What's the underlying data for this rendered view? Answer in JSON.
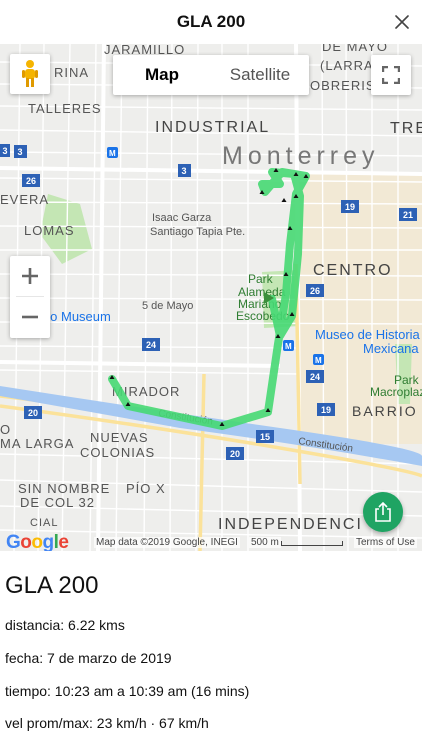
{
  "header": {
    "title": "GLA 200",
    "close_icon": "close-icon"
  },
  "map": {
    "type_control": {
      "map_label": "Map",
      "satellite_label": "Satellite",
      "selected": "Map"
    },
    "labels": {
      "jaramillo": "JARAMILLO",
      "de_mayo": "DE MAYO",
      "larra": "(LARRA",
      "obreris": "OBRERIS",
      "rina": "RINA",
      "talleres": "TALLERES",
      "industrial": "INDUSTRIAL",
      "tre": "TRE",
      "monterrey": "Monterrey",
      "evera": "EVERA",
      "isaac_garza": "Isaac Garza",
      "santiago_tapia": "Santiago Tapia Pte.",
      "lomas": "LOMAS",
      "centro": "CENTRO",
      "park": "Park",
      "alameda": "Alameda",
      "mariano": "Mariano",
      "escobedo": "Escobedo",
      "cinco_de_mayo": "5 de Mayo",
      "pabado_museum": "pabado Museum",
      "museo_historia_1": "Museo de Historia",
      "museo_historia_2": "Mexicana",
      "park2": "Park",
      "macroplaza": "Macroplaza",
      "mirador": "MIRADOR",
      "barrio": "BARRIO",
      "constitucion_1": "Constitución",
      "constitucion_2": "Constitución",
      "o": "O",
      "ma_larga": "MA LARGA",
      "nuevas_colonias_1": "NUEVAS",
      "nuevas_colonias_2": "COLONIAS",
      "sin_nombre": "SIN NOMBRE",
      "de_col_32": "DE COL 32",
      "pio_x": "PÍO X",
      "independencia": "INDEPENDENCI",
      "cial": "CIAL"
    },
    "road_shields": [
      "3",
      "3",
      "3",
      "26",
      "19",
      "21",
      "26",
      "24",
      "24",
      "19",
      "20",
      "15",
      "20"
    ],
    "colors": {
      "route": "#46d873",
      "map_bg": "#eeeeec",
      "share_button": "#1fa463",
      "water": "#a6c8f2",
      "park": "#c4e6b4"
    },
    "attribution": {
      "logo": "Google",
      "data": "Map data ©2019 Google, INEGI",
      "scale": "500 m",
      "terms": "Terms of Use"
    }
  },
  "trip": {
    "title": "GLA 200",
    "distance": "distancia: 6.22 kms",
    "date": "fecha: 7 de marzo de 2019",
    "time": "tiempo: 10:23 am a 10:39 am (16 mins)",
    "speed": "vel prom/max: 23 km/h · 67 km/h"
  }
}
